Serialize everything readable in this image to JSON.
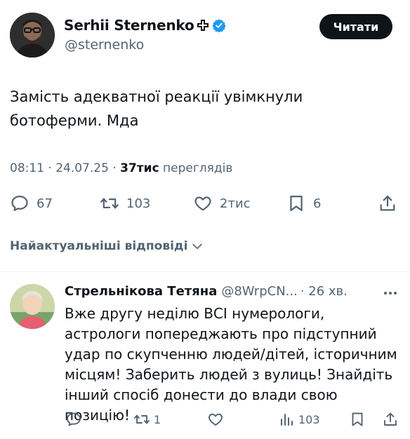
{
  "tweet": {
    "author_name": "Serhii Sternenko",
    "handle": "@sternenko",
    "follow_label": "Читати",
    "text": "Замість адекватної реакції увімкнули ботоферми. Мда",
    "time": "08:11",
    "date": "24.07.25",
    "views_count": "37тис",
    "views_label": "переглядів",
    "replies": "67",
    "retweets": "103",
    "likes": "2тис",
    "bookmarks": "6"
  },
  "sort_label": "Найактуальніші відповіді",
  "reply": {
    "author_name": "Стрельнікова Тетяна",
    "handle": "@8WrpCN...",
    "time": "· 26 хв.",
    "text": "Вже другу неділю ВСІ нумерологи, астрологи попереджають про підступний удар по скупченню людей/дітей, історичним місцям! Заберить людей з вулиць! Знайдіть інший спосіб донести до влади свою позицію!",
    "retweets": "1",
    "views": "103"
  },
  "colors": {
    "primary_text": "#0f1419",
    "secondary_text": "#536471",
    "verified_blue": "#1d9bf0",
    "button_bg": "#0f1419"
  }
}
